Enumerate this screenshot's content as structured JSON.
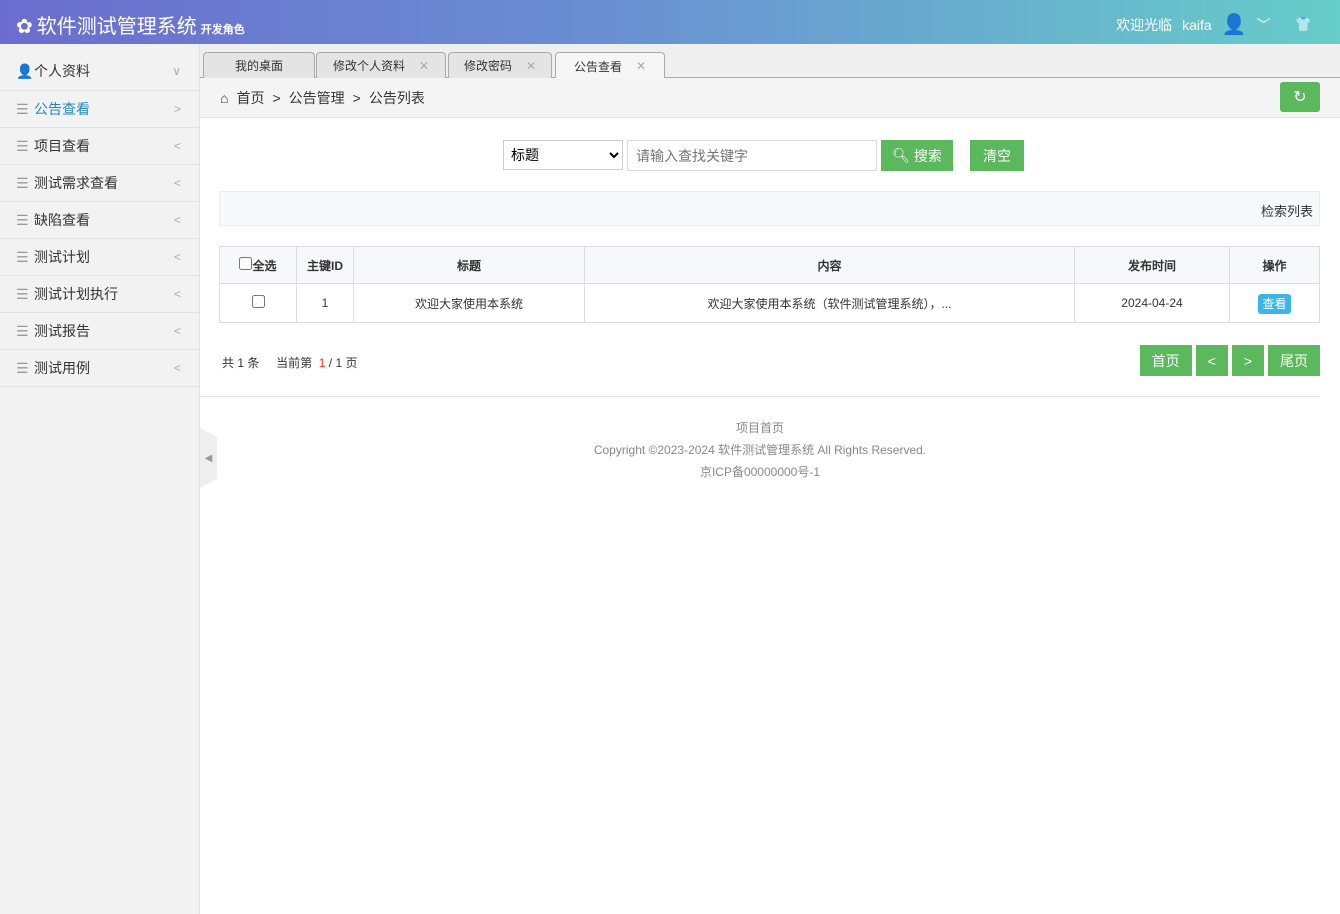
{
  "header": {
    "title": "软件测试管理系统",
    "role": "开发角色",
    "welcome": "欢迎光临",
    "username": "kaifa"
  },
  "sidebar": {
    "items": [
      {
        "label": "个人资料",
        "arrow": "∨"
      },
      {
        "label": "公告查看",
        "arrow": ">"
      },
      {
        "label": "项目查看",
        "arrow": "<"
      },
      {
        "label": "测试需求查看",
        "arrow": "<"
      },
      {
        "label": "缺陷查看",
        "arrow": "<"
      },
      {
        "label": "测试计划",
        "arrow": "<"
      },
      {
        "label": "测试计划执行",
        "arrow": "<"
      },
      {
        "label": "测试报告",
        "arrow": "<"
      },
      {
        "label": "测试用例",
        "arrow": "<"
      }
    ]
  },
  "tabs": [
    {
      "label": "我的桌面"
    },
    {
      "label": "修改个人资料"
    },
    {
      "label": "修改密码"
    },
    {
      "label": "公告查看"
    }
  ],
  "breadcrumb": [
    "首页",
    "公告管理",
    "公告列表"
  ],
  "search": {
    "field": "标题",
    "placeholder": "请输入查找关键字",
    "search_label": "搜索",
    "clear_label": "清空"
  },
  "panel_title": "检索列表",
  "table": {
    "headers": {
      "select_all": "全选",
      "id": "主键ID",
      "title": "标题",
      "content": "内容",
      "time": "发布时间",
      "action": "操作"
    },
    "rows": [
      {
        "id": "1",
        "title": "欢迎大家使用本系统",
        "content": "欢迎大家使用本系统（软件测试管理系统），...",
        "time": "2024-04-24",
        "action": "查看"
      }
    ]
  },
  "pager": {
    "total_prefix": "共",
    "total": "1",
    "total_suffix": "条",
    "current_prefix": "当前第",
    "current": "1",
    "pages": "/ 1 页",
    "first": "首页",
    "prev": "<",
    "next": ">",
    "last": "尾页"
  },
  "footer": {
    "home": "项目首页",
    "copyright": "Copyright ©2023-2024 软件测试管理系统 All Rights Reserved.",
    "icp": "京ICP备00000000号-1"
  }
}
